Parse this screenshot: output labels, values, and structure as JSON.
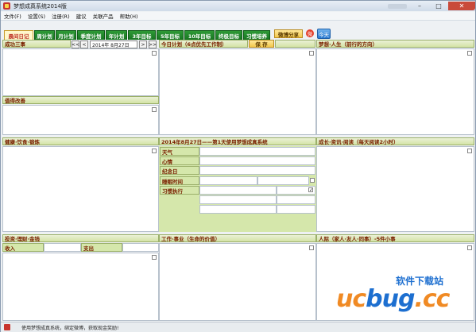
{
  "window": {
    "title": "梦想成真系统2014版",
    "minimize": "–",
    "maximize": "□",
    "close": "✕"
  },
  "menu": [
    "文件(F)",
    "设置(S)",
    "注册(R)",
    "建议",
    "关联产品",
    "帮助(H)"
  ],
  "tabs": [
    "晨间日记",
    "周计划",
    "月计划",
    "季度计划",
    "年计划",
    "3年目标",
    "5年目标",
    "10年目标",
    "终极目标",
    "习惯培养"
  ],
  "buttons": {
    "weibo_share": "微博分享",
    "save": "保 存",
    "today_nav": "今天"
  },
  "date": {
    "prev_prev": "<<",
    "prev": "<",
    "value": "2014年 8月27日",
    "next": ">",
    "next_next": ">>"
  },
  "sections": {
    "success": "成功三事",
    "improve": "值得改善",
    "today_plan": "今日计划（6点优先工作制）",
    "dream": "梦想·人生（前行的方向）",
    "health": "健康·饮食·锻炼",
    "diary_header": "2014年8月27日——第1天使用梦想成真系统",
    "growth": "成长·资讯·阅读（每天阅读2小时）",
    "invest": "投资·理财·金钱",
    "work": "工作·事业（生命的价值）",
    "people": "人际（家人·友人·同事）-5件小事"
  },
  "fields": {
    "weather": "天气",
    "mood": "心情",
    "memorial": "纪念日",
    "sleep": "睡眠时间",
    "habit": "习惯执行"
  },
  "money": {
    "income": "收入",
    "expense": "支出"
  },
  "status": {
    "text": "使用梦想成真系统，绑定微博，获取现金奖励!"
  },
  "watermark": {
    "cn": "软件下载站",
    "brand_a": "uc",
    "brand_b": "bug",
    "suffix": ".cc"
  },
  "colors": {
    "tab_green": "#167522",
    "header_text": "#7a2000",
    "accent_blue": "#1d6fd0",
    "accent_orange": "#f08a24"
  }
}
